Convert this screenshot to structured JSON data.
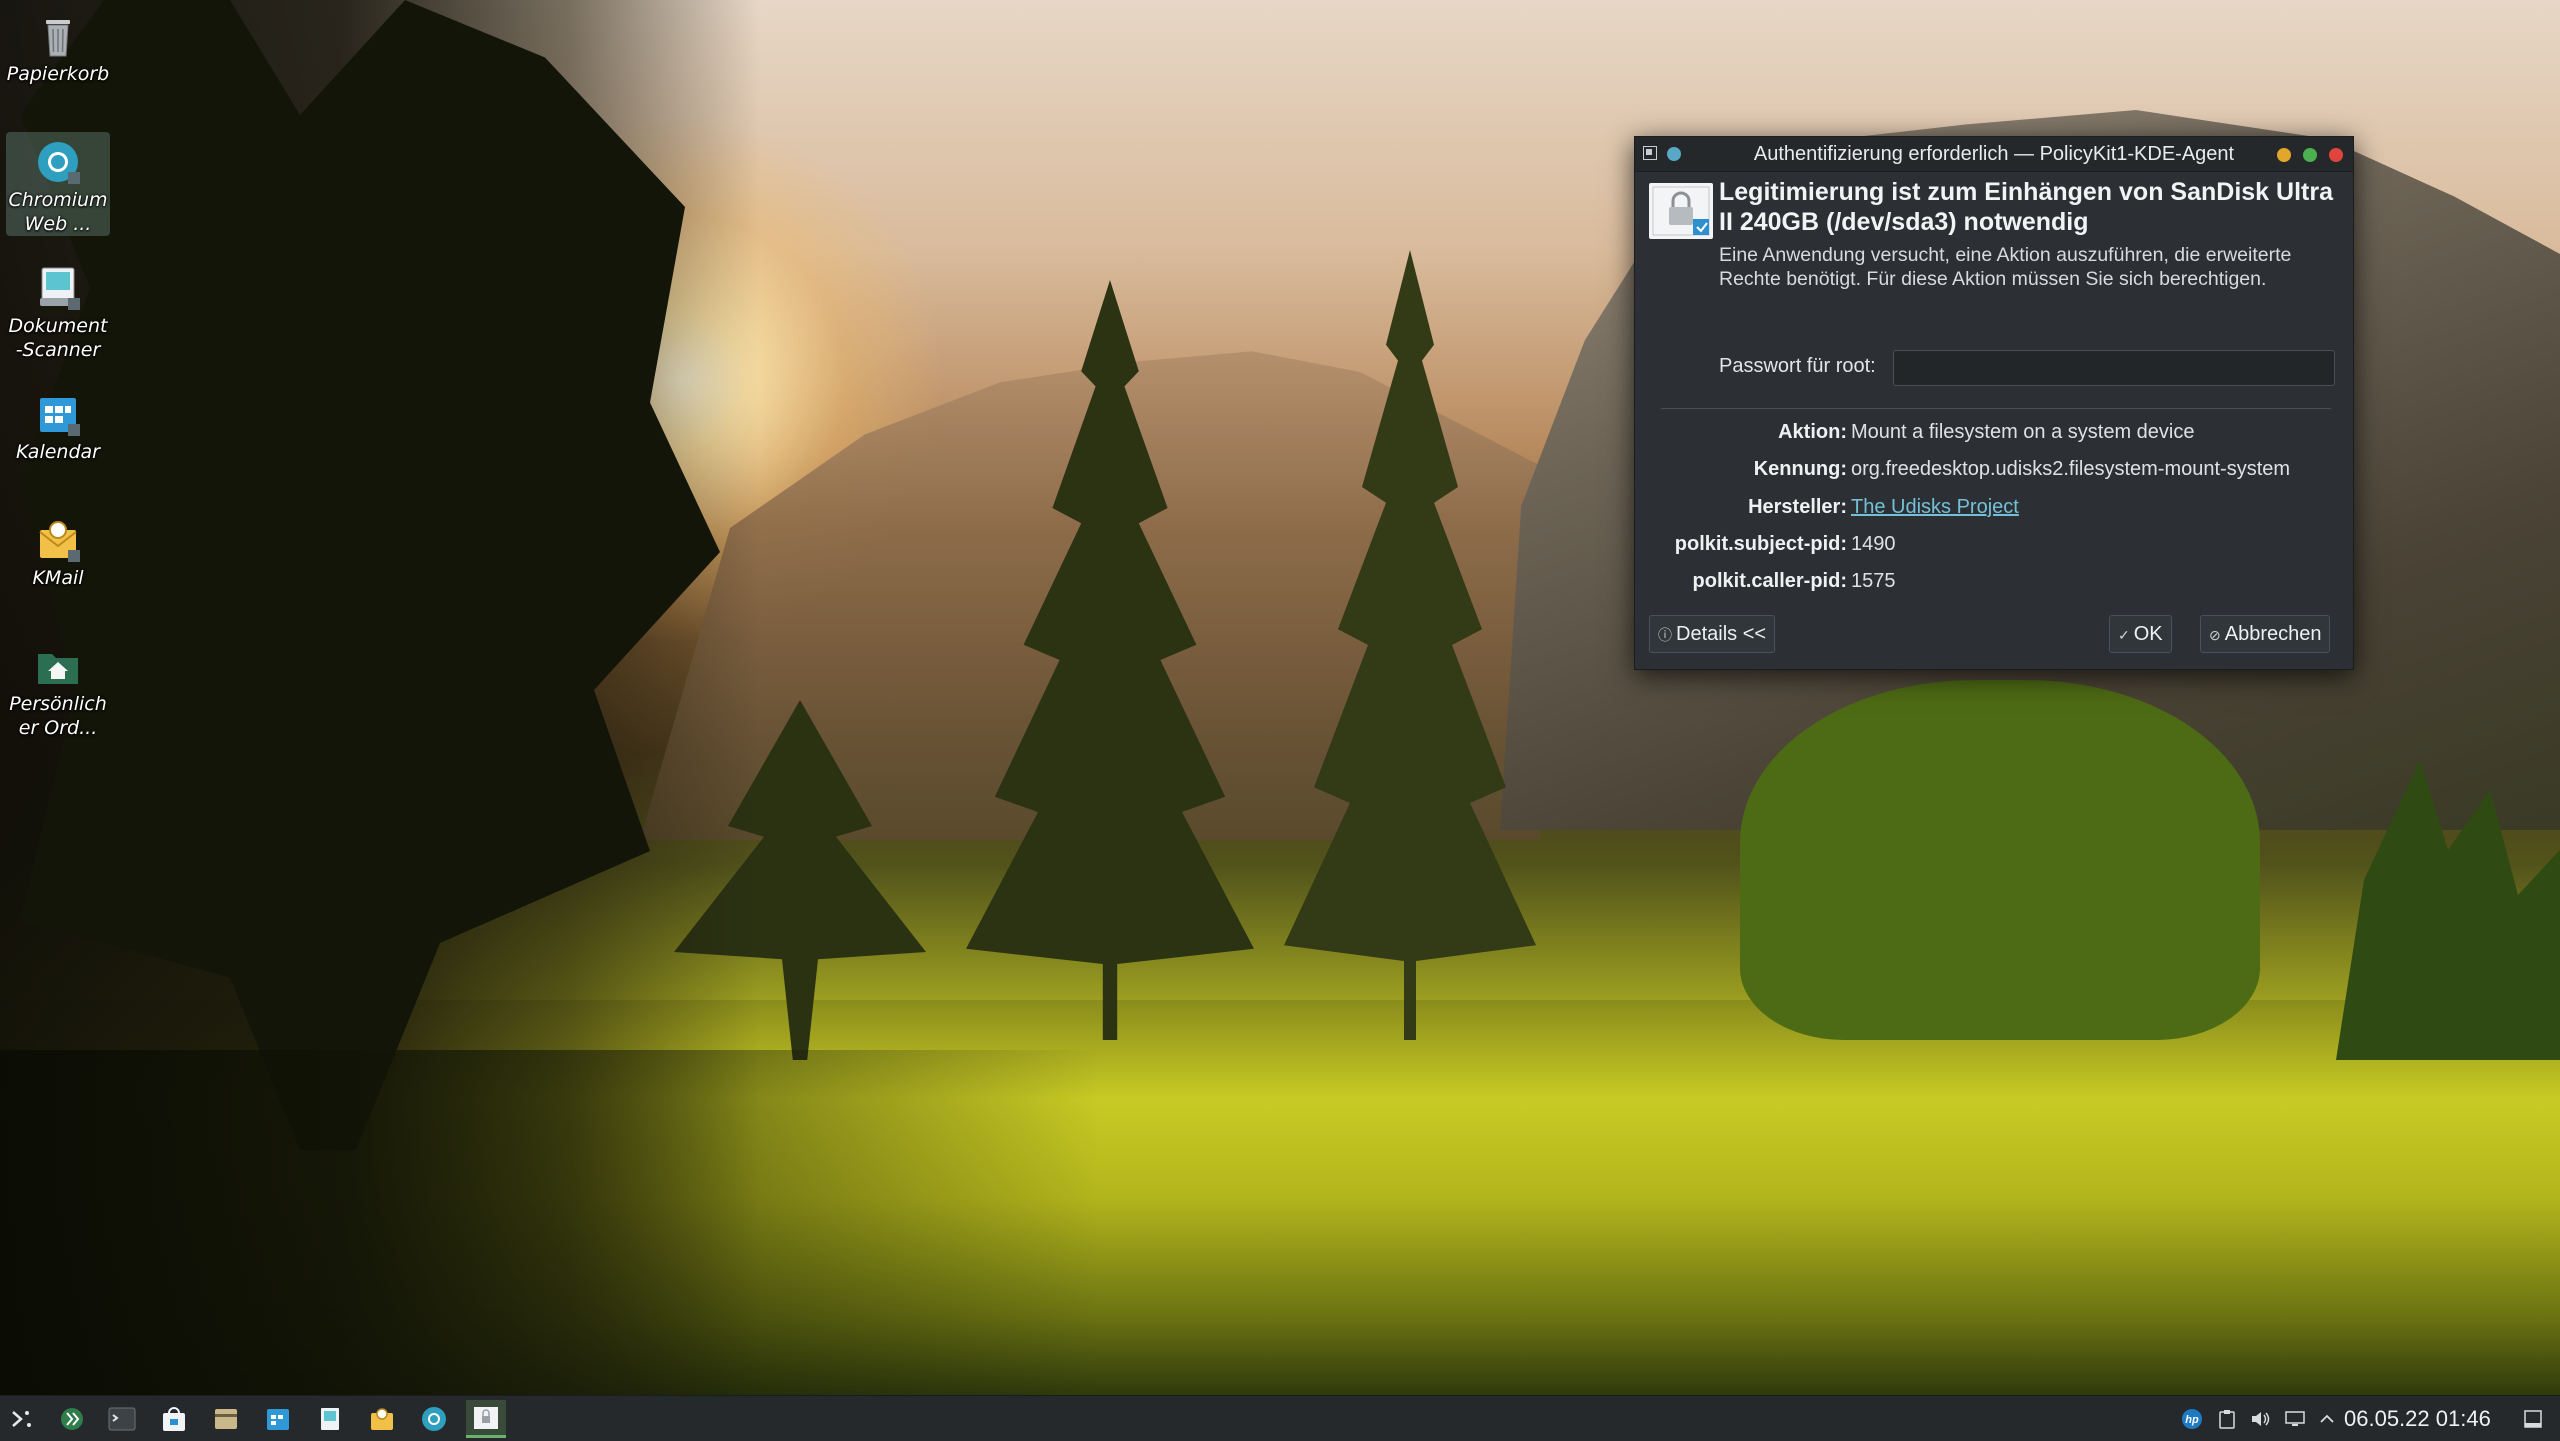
{
  "desktop": {
    "icons": [
      {
        "label": "Papierkorb",
        "icon": "trash-icon"
      },
      {
        "label": "Chromium Web ...",
        "icon": "chromium-icon"
      },
      {
        "label": "Dokument-Scanner",
        "icon": "scanner-icon"
      },
      {
        "label": "Kalendar",
        "icon": "calendar-icon"
      },
      {
        "label": "KMail",
        "icon": "kmail-icon"
      },
      {
        "label": "Persönlicher Ord...",
        "icon": "home-folder-icon"
      }
    ]
  },
  "dialog": {
    "title": "Authentifizierung erforderlich — PolicyKit1-KDE-Agent",
    "headline": "Legitimierung ist zum Einhängen von SanDisk Ultra II 240GB (/dev/sda3) notwendig",
    "description": "Eine Anwendung versucht, eine Aktion auszuführen, die erweiterte Rechte benötigt. Für diese Aktion müssen Sie sich berechtigen.",
    "password_label": "Passwort für root:",
    "password_value": "",
    "details": [
      {
        "key": "Aktion:",
        "value": "Mount a filesystem on a system device",
        "link": false
      },
      {
        "key": "Kennung:",
        "value": "org.freedesktop.udisks2.filesystem-mount-system",
        "link": false
      },
      {
        "key": "Hersteller:",
        "value": "The Udisks Project",
        "link": true
      },
      {
        "key": "polkit.subject-pid:",
        "value": "1490",
        "link": false
      },
      {
        "key": "polkit.caller-pid:",
        "value": "1575",
        "link": false
      }
    ],
    "buttons": {
      "details": "Details <<",
      "ok": "OK",
      "cancel": "Abbrechen"
    }
  },
  "taskbar": {
    "launchers": [
      "application-launcher-icon",
      "kde-plasma-icon",
      "terminal-icon",
      "software-store-icon",
      "file-manager-icon",
      "calendar-icon",
      "scanner-icon",
      "kmail-icon",
      "chromium-icon",
      "policykit-window-icon"
    ],
    "tray": [
      "hp-icon",
      "clipboard-icon",
      "volume-icon",
      "network-icon",
      "chevron-up-icon"
    ],
    "clock": "06.05.22 01:46"
  },
  "colors": {
    "dialog_bg": "#2c3034",
    "link": "#74c0d8",
    "close": "#e0453d",
    "minimize": "#e2a72a",
    "maximize": "#4caf50",
    "taskbar_bg": "#26292c"
  }
}
